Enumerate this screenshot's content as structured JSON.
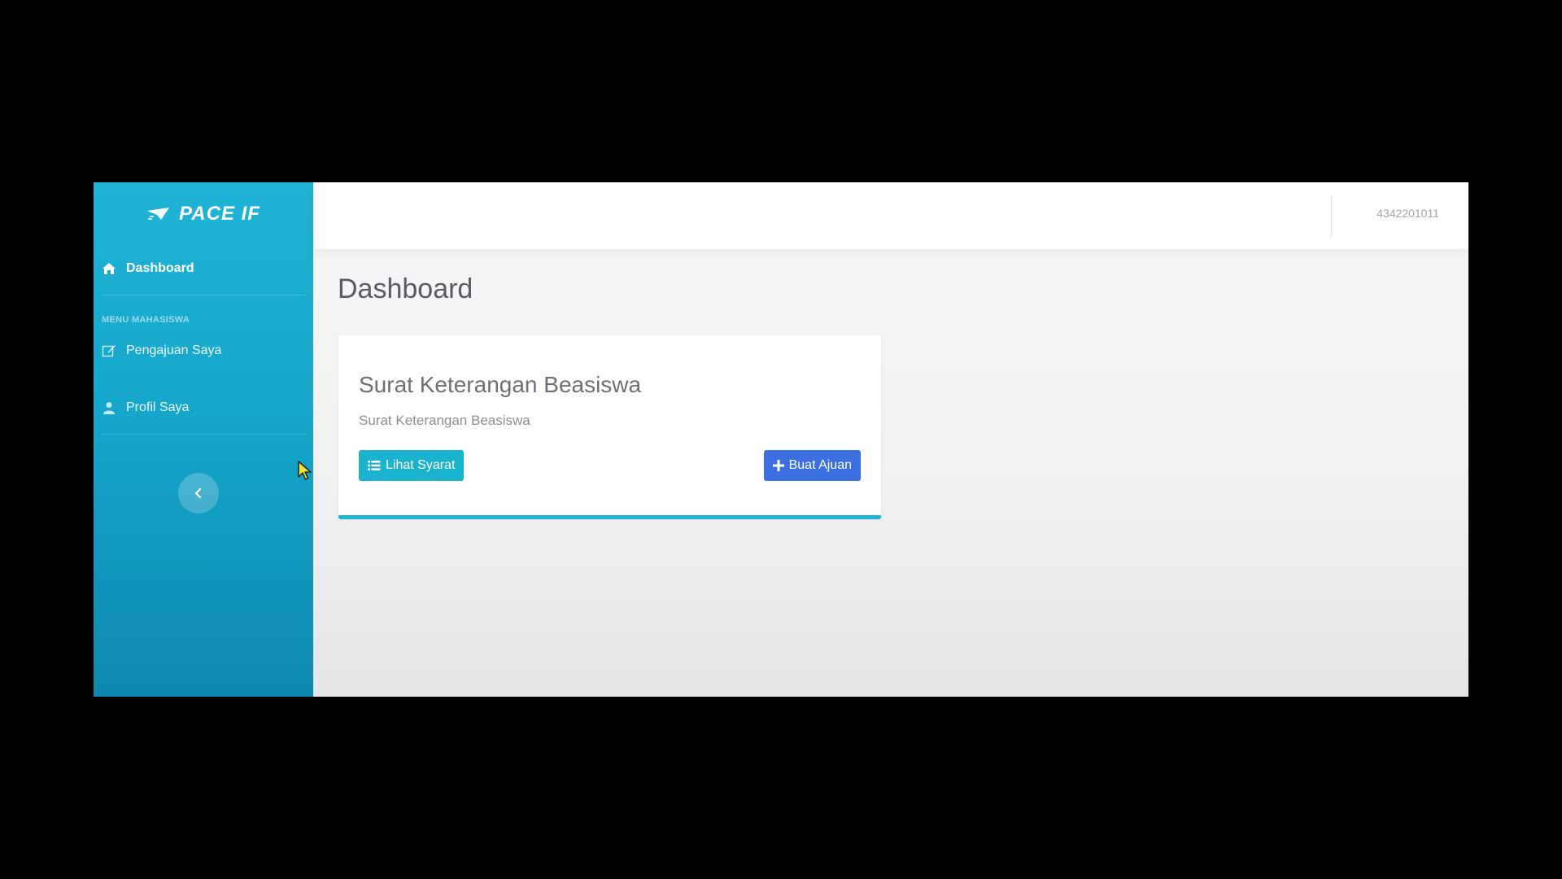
{
  "brand": {
    "name": "PACE IF",
    "logo_icon": "paper-plane-icon"
  },
  "sidebar": {
    "dashboard_label": "Dashboard",
    "dashboard_icon": "home-icon",
    "section_heading": "MENU MAHASISWA",
    "items": [
      {
        "label": "Pengajuan Saya",
        "icon": "edit-icon"
      },
      {
        "label": "Profil Saya",
        "icon": "user-icon"
      }
    ],
    "collapse_icon": "chevron-left-icon"
  },
  "topbar": {
    "user_id": "4342201011"
  },
  "main": {
    "page_title": "Dashboard",
    "card": {
      "title": "Surat Keterangan Beasiswa",
      "subtitle": "Surat Keterangan Beasiswa",
      "buttons": {
        "view_requirements": {
          "label": "Lihat Syarat",
          "icon": "list-icon"
        },
        "create_request": {
          "label": "Buat Ajuan",
          "icon": "plus-icon"
        }
      }
    }
  },
  "colors": {
    "sidebar": "#1fb4d6",
    "info_button": "#1cb3cf",
    "primary_button": "#3b6fe0",
    "card_accent": "#1fb4d6"
  }
}
